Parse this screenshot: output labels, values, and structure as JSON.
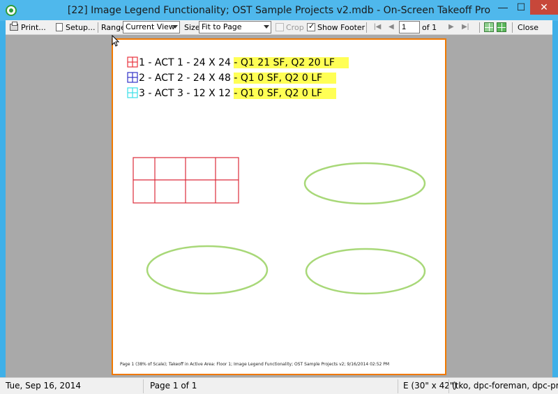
{
  "window": {
    "title": "[22] Image Legend Functionality; OST Sample Projects v2.mdb - On-Screen Takeoff Pro",
    "min_glyph": "—",
    "max_glyph": "☐",
    "close_glyph": "✕"
  },
  "toolbar": {
    "print_label": "Print...",
    "setup_label": "Setup...",
    "range_label": "Range",
    "range_value": "Current View",
    "size_label": "Size",
    "size_value": "Fit to Page",
    "crop_label": "Crop",
    "show_footer_label": "Show Footer",
    "page_value": "1",
    "page_of": "of 1",
    "close_label": "Close",
    "nav_first": "|◀",
    "nav_prev": "◀",
    "nav_next": "▶",
    "nav_last": "▶|"
  },
  "page": {
    "legend": [
      {
        "label": "1 - ACT 1 - 24 X 24 ",
        "quantity": "- Q1 21 SF, Q2 20 LF",
        "color": "#e8323c"
      },
      {
        "label": "2 - ACT 2 - 24 X 48 ",
        "quantity": "- Q1 0 SF, Q2 0 LF",
        "color": "#3232c8"
      },
      {
        "label": "3 - ACT 3 - 12 X 12 ",
        "quantity": "- Q1 0 SF, Q2 0 LF",
        "color": "#38e0e8"
      }
    ],
    "footer": "Page 1 (38% of Scale); Takeoff in Active Area: Floor 1; Image Legend Functionality; OST Sample Projects v2; 9/16/2014 02:52 PM",
    "grid_color": "#dc2b3a",
    "ellipse_color": "#a8d878"
  },
  "statusbar": {
    "date": "Tue, Sep 16, 2014",
    "page": "Page 1 of 1",
    "sheet_size": "E (30\" x 42\")",
    "user": "(tko, dpc-foreman, dpc-pro"
  }
}
